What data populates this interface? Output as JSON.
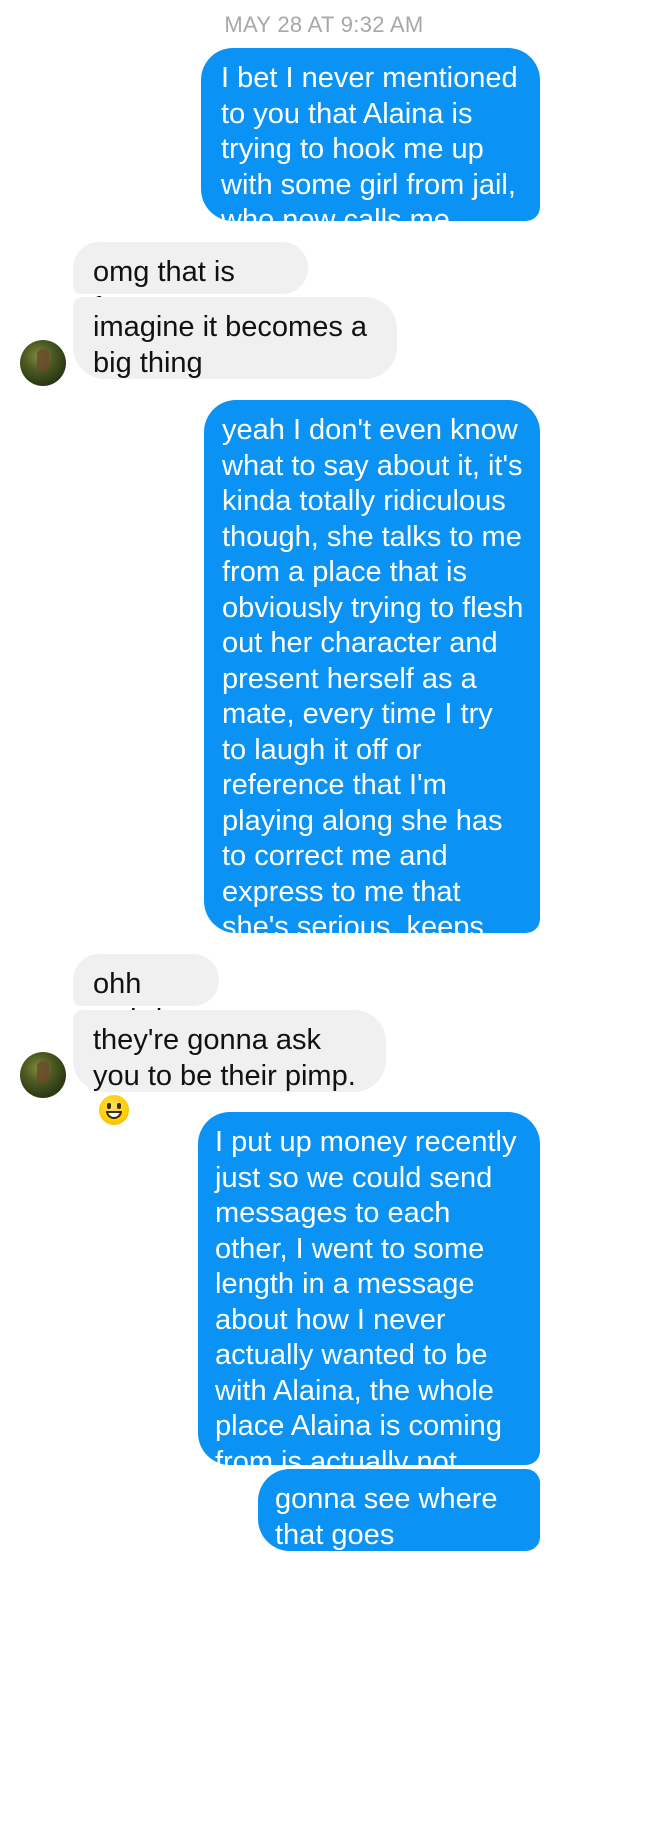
{
  "thread": {
    "timestamp": "MAY 28 AT 9:32 AM",
    "messages": [
      {
        "from": "me",
        "text": "I bet I never mentioned to you that Alaina is trying to hook me up with some girl from jail, who now calls me"
      },
      {
        "from": "them",
        "text": "omg that is funny"
      },
      {
        "from": "them",
        "text": "imagine it becomes a big thing"
      },
      {
        "from": "me",
        "text": "yeah I don't even know what to say about it, it's kinda totally ridiculous though, she talks to me from a place that is obviously trying to flesh out her character and present herself as a mate, every time I try to laugh it off or reference that I'm playing along she has to correct me and express to me that she's serious, keeps intentionally updating me about how much she likes me so far, what the fuck"
      },
      {
        "from": "them",
        "text": "ohh weird"
      },
      {
        "from": "them",
        "text": "they're gonna ask you to be their pimp.",
        "emoji": "grinning-face-emoji"
      },
      {
        "from": "me",
        "text": "I put up money recently just so we could send messages to each other, I went to some length in a message about how I never actually wanted to be with Alaina, the whole place Alaina is coming from is actually not even an accurate picture of how much I am shopping"
      },
      {
        "from": "me",
        "text": "gonna see where that goes"
      }
    ]
  },
  "colors": {
    "outgoing_bubble": "#0a93f5",
    "incoming_bubble": "#f0f0f0",
    "timestamp": "#a8a8a8"
  }
}
